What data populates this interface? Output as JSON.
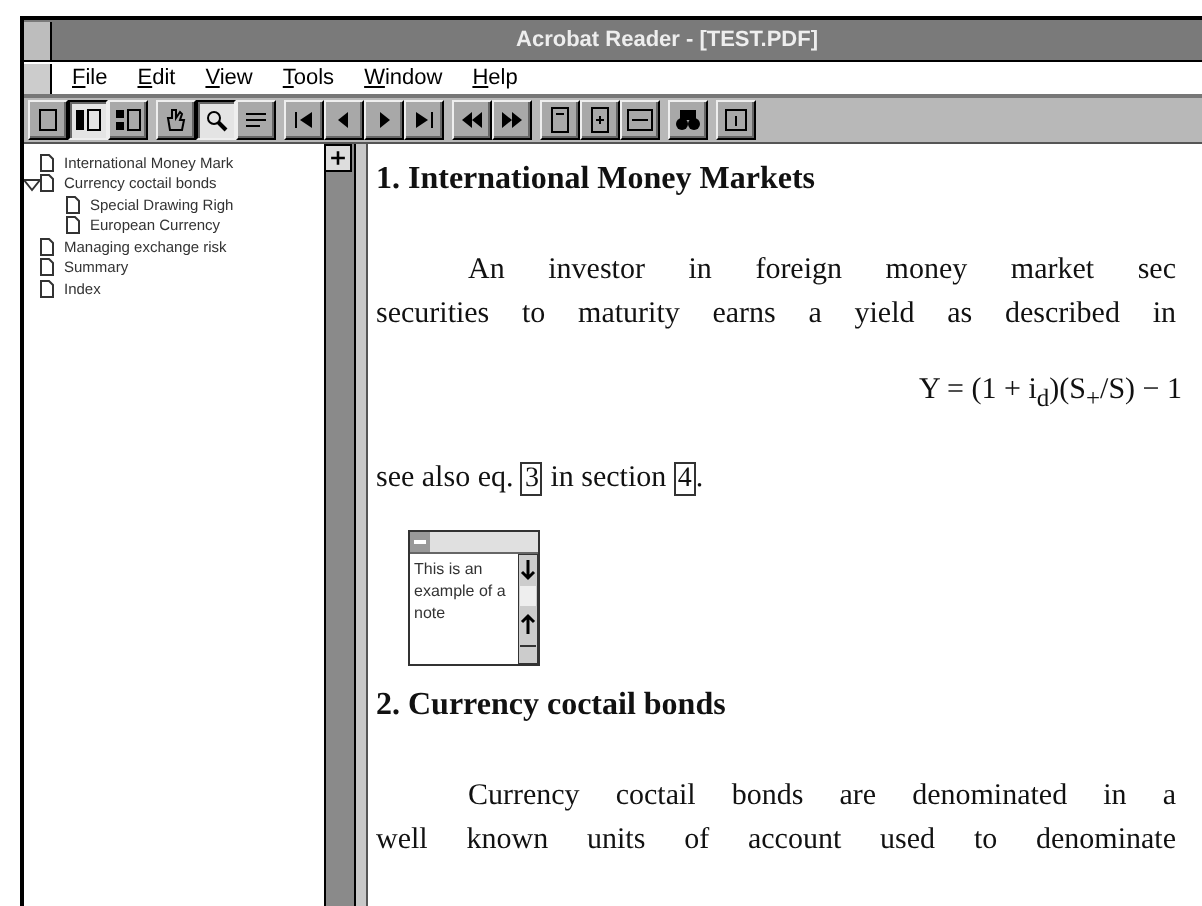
{
  "window": {
    "title": "Acrobat Reader - [TEST.PDF]"
  },
  "menu": [
    {
      "label": "File"
    },
    {
      "label": "Edit"
    },
    {
      "label": "View"
    },
    {
      "label": "Tools"
    },
    {
      "label": "Window"
    },
    {
      "label": "Help"
    }
  ],
  "toolbar": [
    [
      {
        "kind": "page",
        "pressed": false
      },
      {
        "kind": "bookmarks",
        "pressed": true
      },
      {
        "kind": "thumbnails",
        "pressed": false
      }
    ],
    [
      {
        "kind": "hand",
        "pressed": false
      },
      {
        "kind": "zoom",
        "pressed": true
      },
      {
        "kind": "select",
        "pressed": false
      }
    ],
    [
      {
        "kind": "first",
        "pressed": false
      },
      {
        "kind": "prev",
        "pressed": false
      },
      {
        "kind": "next",
        "pressed": false
      },
      {
        "kind": "last",
        "pressed": false
      }
    ],
    [
      {
        "kind": "back",
        "pressed": false
      },
      {
        "kind": "forward",
        "pressed": false
      }
    ],
    [
      {
        "kind": "actual",
        "pressed": false
      },
      {
        "kind": "fitpage",
        "pressed": false
      },
      {
        "kind": "fitwidth",
        "pressed": false
      }
    ],
    [
      {
        "kind": "find",
        "pressed": false
      }
    ],
    [
      {
        "kind": "info",
        "pressed": false
      }
    ]
  ],
  "bookmarks": [
    {
      "label": "International Money Mark",
      "expanded": false
    },
    {
      "label": "Currency coctail bonds",
      "expanded": true,
      "children": [
        {
          "label": "Special Drawing Righ",
          "expanded": false
        },
        {
          "label": "European Currency",
          "expanded": false
        }
      ]
    },
    {
      "label": "Managing exchange risk",
      "expanded": false
    },
    {
      "label": "Summary",
      "expanded": false
    },
    {
      "label": "Index",
      "expanded": false
    }
  ],
  "document": [
    {
      "kind": "heading",
      "text": "1. International Money Markets"
    },
    {
      "kind": "paragraph",
      "lines": [
        "An investor in foreign money market sec",
        "securities to maturity earns a yield as described in"
      ]
    },
    {
      "kind": "formula",
      "text": "Y = (1 + i$_{d}$)(S$_{+}$/S) − 1"
    },
    {
      "kind": "refs",
      "parts": [
        {
          "kind": "text",
          "text": "see also eq. "
        },
        {
          "kind": "link",
          "text": "3"
        },
        {
          "kind": "text",
          "text": " in section "
        },
        {
          "kind": "link",
          "text": "4"
        },
        {
          "kind": "text",
          "text": "."
        }
      ]
    },
    {
      "kind": "note",
      "text": "This is an example of a note"
    },
    {
      "kind": "heading",
      "text": "2. Currency coctail bonds"
    },
    {
      "kind": "paragraph",
      "lines": [
        "Currency coctail bonds are denominated in a",
        "well known units of account used to denominate"
      ]
    }
  ]
}
